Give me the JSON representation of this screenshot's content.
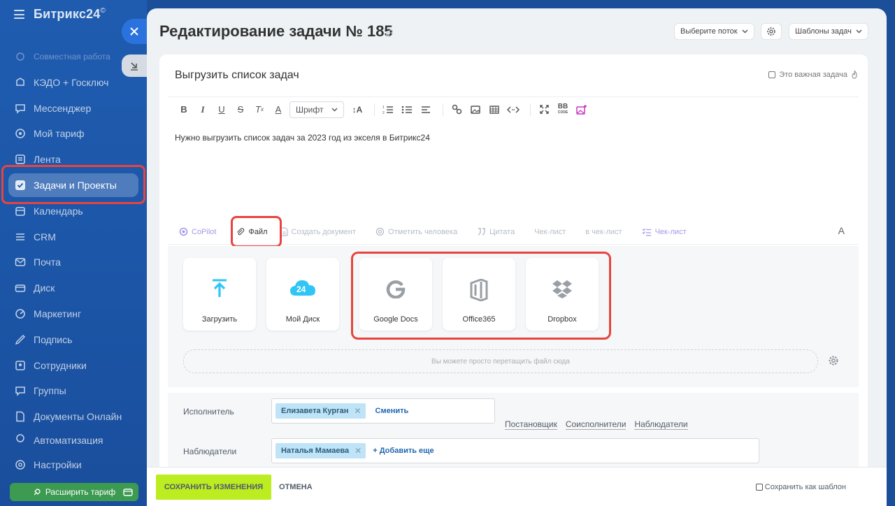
{
  "sidebar": {
    "brand": "Битрикс24",
    "brand_mark": "©",
    "items": [
      {
        "label": "Совместная работа",
        "icon": "collab-icon"
      },
      {
        "label": "КЭДО + Госключ",
        "icon": "hr-docs-icon"
      },
      {
        "label": "Мессенджер",
        "icon": "chat-icon"
      },
      {
        "label": "Мой тариф",
        "icon": "plan-icon"
      },
      {
        "label": "Лента",
        "icon": "feed-icon"
      },
      {
        "label": "Задачи и Проекты",
        "icon": "tasks-icon"
      },
      {
        "label": "Календарь",
        "icon": "calendar-icon"
      },
      {
        "label": "CRM",
        "icon": "crm-icon"
      },
      {
        "label": "Почта",
        "icon": "mail-icon"
      },
      {
        "label": "Диск",
        "icon": "disk-icon"
      },
      {
        "label": "Маркетинг",
        "icon": "marketing-icon"
      },
      {
        "label": "Подпись",
        "icon": "sign-icon"
      },
      {
        "label": "Сотрудники",
        "icon": "employees-icon"
      },
      {
        "label": "Группы",
        "icon": "groups-icon"
      },
      {
        "label": "Документы Онлайн",
        "icon": "docs-online-icon"
      },
      {
        "label": "Автоматизация",
        "icon": "automation-icon"
      },
      {
        "label": "Настройки",
        "icon": "settings-icon"
      }
    ],
    "upgrade_label": "Расширить тариф"
  },
  "header": {
    "title": "Редактирование задачи № 185",
    "flow_select": "Выберите поток",
    "templates_button": "Шаблоны задач"
  },
  "task": {
    "name": "Выгрузить список задач",
    "important_label": "Это важная задача",
    "body": "Нужно выгрузить список задач за 2023 год из экселя в Битрикс24"
  },
  "editor": {
    "font_select": "Шрифт"
  },
  "actions": {
    "copilot": "CoPilot",
    "file": "Файл",
    "create_doc": "Создать документ",
    "mention": "Отметить человека",
    "quote": "Цитата",
    "checklist_plain": "Чек-лист",
    "to_checklist": "в чек-лист",
    "checklist": "Чек-лист",
    "font_toggle": "A"
  },
  "upload": {
    "tiles": [
      {
        "label": "Загрузить",
        "icon": "upload-arrow-icon"
      },
      {
        "label": "Мой Диск",
        "icon": "cloud-24-icon"
      },
      {
        "label": "Google Docs",
        "icon": "google-icon"
      },
      {
        "label": "Office365",
        "icon": "office-icon"
      },
      {
        "label": "Dropbox",
        "icon": "dropbox-icon"
      }
    ],
    "dropzone_text": "Вы можете просто перетащить файл сюда"
  },
  "responsible": {
    "label": "Исполнитель",
    "person": "Елизавета Курган",
    "change_link": "Сменить",
    "roles": [
      "Постановщик",
      "Соисполнители",
      "Наблюдатели"
    ]
  },
  "observers": {
    "label": "Наблюдатели",
    "person": "Наталья Мамаева",
    "add_link": "+ Добавить еще"
  },
  "footer": {
    "save": "СОХРАНИТЬ ИЗМЕНЕНИЯ",
    "cancel": "ОТМЕНА",
    "save_template": "Сохранить как шаблон"
  },
  "colors": {
    "sidebar": "#1f5cb0",
    "accent_green": "#bbed21",
    "highlight_red": "#e8443e",
    "chip_blue": "#bfe4f7"
  }
}
